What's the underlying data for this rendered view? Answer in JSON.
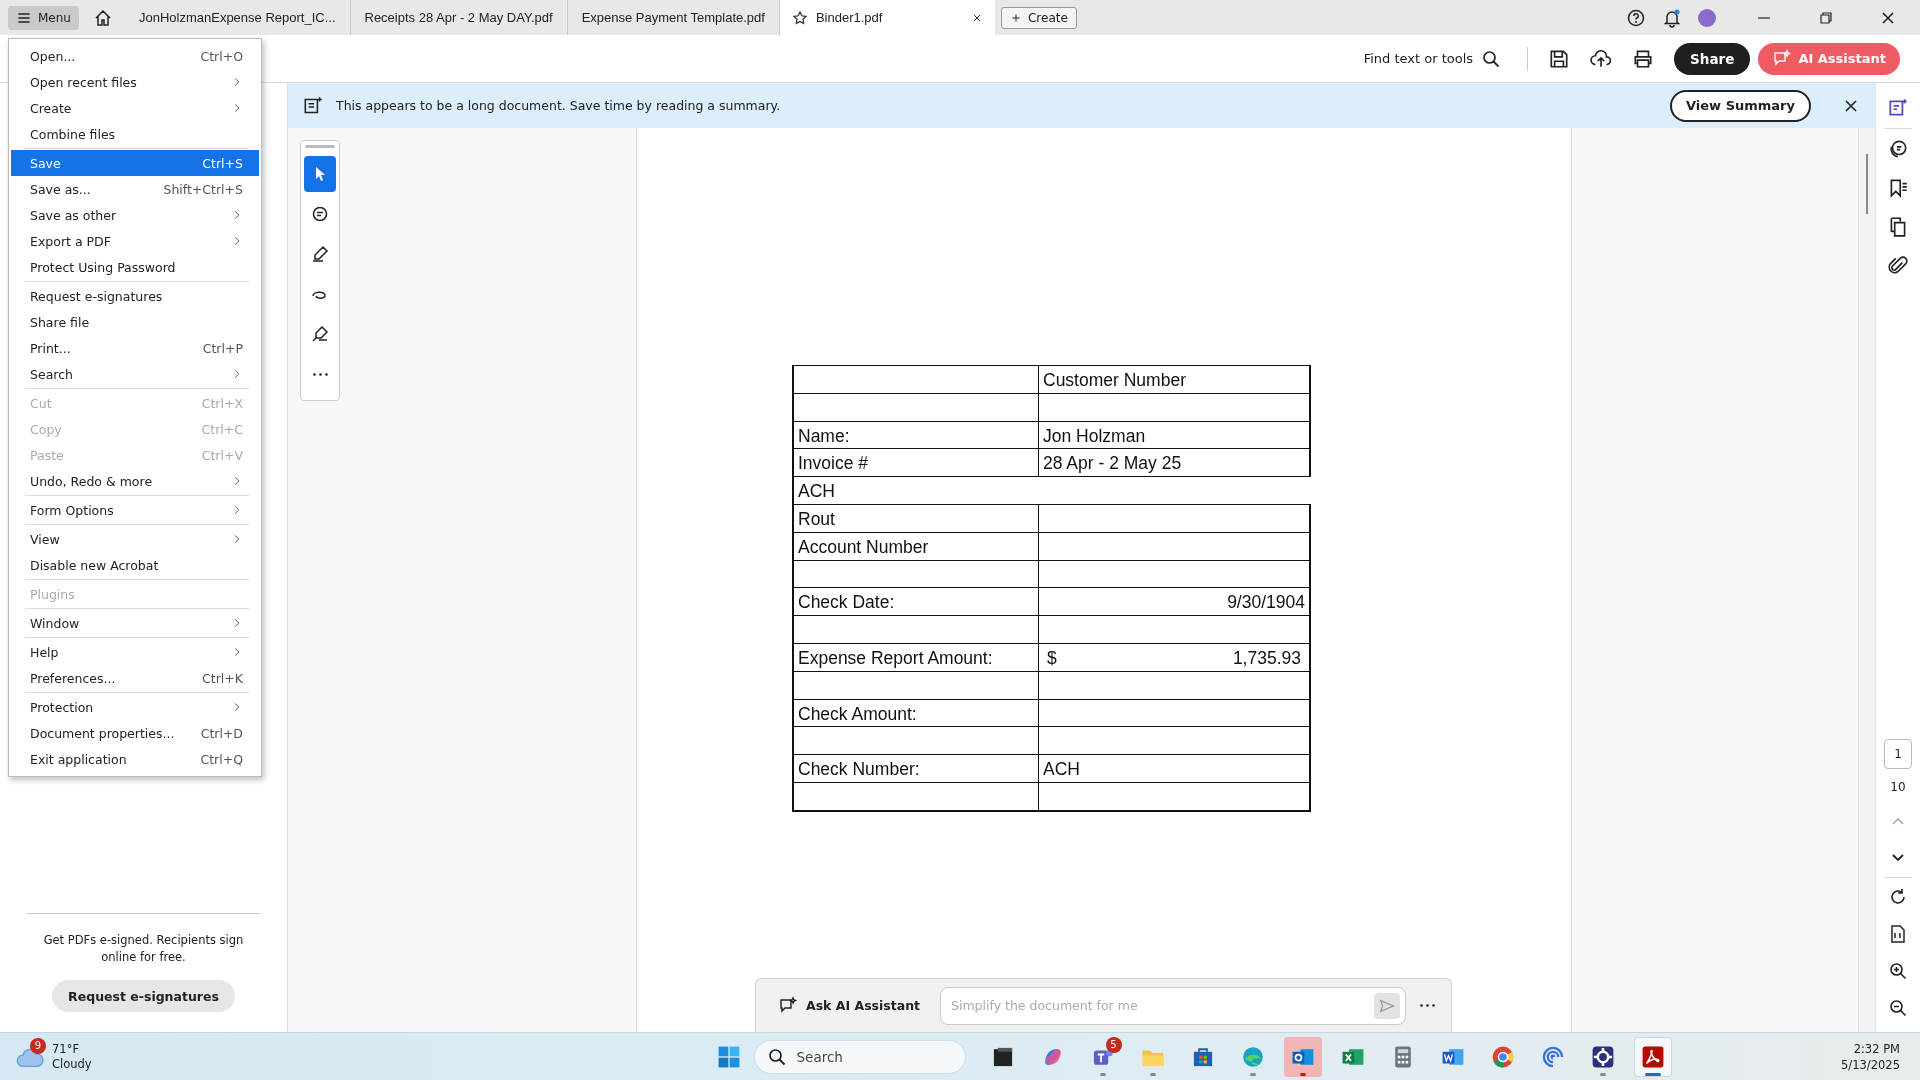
{
  "tabs": [
    {
      "label": "JonHolzmanExpense Report_IC...",
      "selected": false
    },
    {
      "label": "Receipts 28 Apr - 2 May DAY.pdf",
      "selected": false
    },
    {
      "label": "Expense Payment Template.pdf",
      "selected": false
    },
    {
      "label": "Binder1.pdf",
      "selected": true
    }
  ],
  "menu_button": "Menu",
  "create_button": "Create",
  "toolbar": {
    "find": "Find text or tools",
    "share": "Share",
    "ai_assistant": "AI Assistant"
  },
  "banner": {
    "text": "This appears to be a long document. Save time by reading a summary.",
    "button": "View Summary"
  },
  "menu": [
    {
      "label": "Open...",
      "shortcut": "Ctrl+O",
      "selected": false,
      "disabled": false
    },
    {
      "label": "Open recent files",
      "submenu": true,
      "selected": false,
      "disabled": false
    },
    {
      "label": "Create",
      "submenu": true,
      "selected": false,
      "disabled": false
    },
    {
      "label": "Combine files",
      "separator_after": true,
      "selected": false,
      "disabled": false
    },
    {
      "label": "Save",
      "shortcut": "Ctrl+S",
      "selected": true,
      "disabled": false
    },
    {
      "label": "Save as...",
      "shortcut": "Shift+Ctrl+S",
      "selected": false,
      "disabled": false
    },
    {
      "label": "Save as other",
      "submenu": true,
      "selected": false,
      "disabled": false
    },
    {
      "label": "Export a PDF",
      "submenu": true,
      "selected": false,
      "disabled": false
    },
    {
      "label": "Protect Using Password",
      "separator_after": true,
      "selected": false,
      "disabled": false
    },
    {
      "label": "Request e-signatures",
      "selected": false,
      "disabled": false
    },
    {
      "label": "Share file",
      "selected": false,
      "disabled": false
    },
    {
      "label": "Print...",
      "shortcut": "Ctrl+P",
      "selected": false,
      "disabled": false
    },
    {
      "label": "Search",
      "submenu": true,
      "separator_after": true,
      "selected": false,
      "disabled": false
    },
    {
      "label": "Cut",
      "shortcut": "Ctrl+X",
      "selected": false,
      "disabled": true
    },
    {
      "label": "Copy",
      "shortcut": "Ctrl+C",
      "selected": false,
      "disabled": true
    },
    {
      "label": "Paste",
      "shortcut": "Ctrl+V",
      "selected": false,
      "disabled": true
    },
    {
      "label": "Undo, Redo & more",
      "submenu": true,
      "separator_after": true,
      "selected": false,
      "disabled": false
    },
    {
      "label": "Form Options",
      "submenu": true,
      "separator_after": true,
      "selected": false,
      "disabled": false
    },
    {
      "label": "View",
      "submenu": true,
      "selected": false,
      "disabled": false
    },
    {
      "label": "Disable new Acrobat",
      "separator_after": true,
      "selected": false,
      "disabled": false
    },
    {
      "label": "Plugins",
      "separator_after": true,
      "selected": false,
      "disabled": true
    },
    {
      "label": "Window",
      "submenu": true,
      "separator_after": true,
      "selected": false,
      "disabled": false
    },
    {
      "label": "Help",
      "submenu": true,
      "selected": false,
      "disabled": false
    },
    {
      "label": "Preferences...",
      "shortcut": "Ctrl+K",
      "separator_after": true,
      "selected": false,
      "disabled": false
    },
    {
      "label": "Protection",
      "submenu": true,
      "selected": false,
      "disabled": false
    },
    {
      "label": "Document properties...",
      "shortcut": "Ctrl+D",
      "selected": false,
      "disabled": false
    },
    {
      "label": "Exit application",
      "shortcut": "Ctrl+Q",
      "selected": false,
      "disabled": false
    }
  ],
  "side_promo": {
    "text": "Get PDFs e-signed. Recipients sign online for free.",
    "button": "Request e-signatures"
  },
  "tools": [
    {
      "kind": "select",
      "selected": true
    },
    {
      "kind": "comment",
      "selected": false
    },
    {
      "kind": "highlight",
      "selected": false
    },
    {
      "kind": "draw",
      "selected": false
    },
    {
      "kind": "sign",
      "selected": false
    },
    {
      "kind": "more",
      "selected": false
    }
  ],
  "table": [
    {
      "value": "Customer Number",
      "kind": "pair"
    },
    {
      "kind": "pair"
    },
    {
      "label": "Name:",
      "value": "Jon Holzman",
      "kind": "pair"
    },
    {
      "label": "Invoice #",
      "value": "28 Apr - 2 May 25",
      "kind": "pair"
    },
    {
      "label": "ACH",
      "kind": "span"
    },
    {
      "label": "Rout",
      "kind": "pair"
    },
    {
      "label": "Account Number",
      "kind": "pair"
    },
    {
      "kind": "pair"
    },
    {
      "label": "Check Date:",
      "value": "9/30/1904",
      "kind": "right"
    },
    {
      "kind": "pair"
    },
    {
      "label": "Expense Report Amount:",
      "currency": "$",
      "value": "1,735.93",
      "kind": "amount"
    },
    {
      "kind": "pair"
    },
    {
      "label": "Check Amount:",
      "kind": "pair"
    },
    {
      "kind": "pair"
    },
    {
      "label": "Check Number:",
      "value": "ACH",
      "kind": "pair"
    },
    {
      "kind": "pair"
    }
  ],
  "ask_ai": {
    "button": "Ask AI Assistant",
    "placeholder": "Simplify the document for me"
  },
  "right_rail": {
    "tools": [
      {
        "kind": "ai",
        "selected": true
      },
      {
        "kind": "comments",
        "selected": false
      },
      {
        "kind": "bookmarks",
        "selected": false
      },
      {
        "kind": "pages",
        "selected": false
      },
      {
        "kind": "attachments",
        "selected": false
      }
    ],
    "page": "1",
    "page_count": "10"
  },
  "taskbar": {
    "weather": {
      "badge": "9",
      "temp": "71°F",
      "condition": "Cloudy"
    },
    "search": "Search",
    "apps": [
      {
        "kind": "taskview",
        "running": false,
        "selected": false
      },
      {
        "kind": "copilot",
        "running": false,
        "selected": false
      },
      {
        "kind": "teams",
        "badge": "5",
        "running": true,
        "selected": false
      },
      {
        "kind": "files",
        "running": true,
        "selected": false
      },
      {
        "kind": "store",
        "running": false,
        "selected": false
      },
      {
        "kind": "edge",
        "running": true,
        "selected": false
      },
      {
        "kind": "outlook",
        "running": true,
        "selected": false,
        "attention": true
      },
      {
        "kind": "excel",
        "running": false,
        "selected": false
      },
      {
        "kind": "calculator",
        "running": false,
        "selected": false
      },
      {
        "kind": "word",
        "running": false,
        "selected": false
      },
      {
        "kind": "chrome",
        "running": false,
        "selected": false
      },
      {
        "kind": "spiral",
        "running": false,
        "selected": false
      },
      {
        "kind": "gear",
        "running": true,
        "selected": false
      },
      {
        "kind": "acrobat",
        "running": true,
        "selected": true
      }
    ],
    "time": "2:32 PM",
    "date": "5/13/2025"
  }
}
